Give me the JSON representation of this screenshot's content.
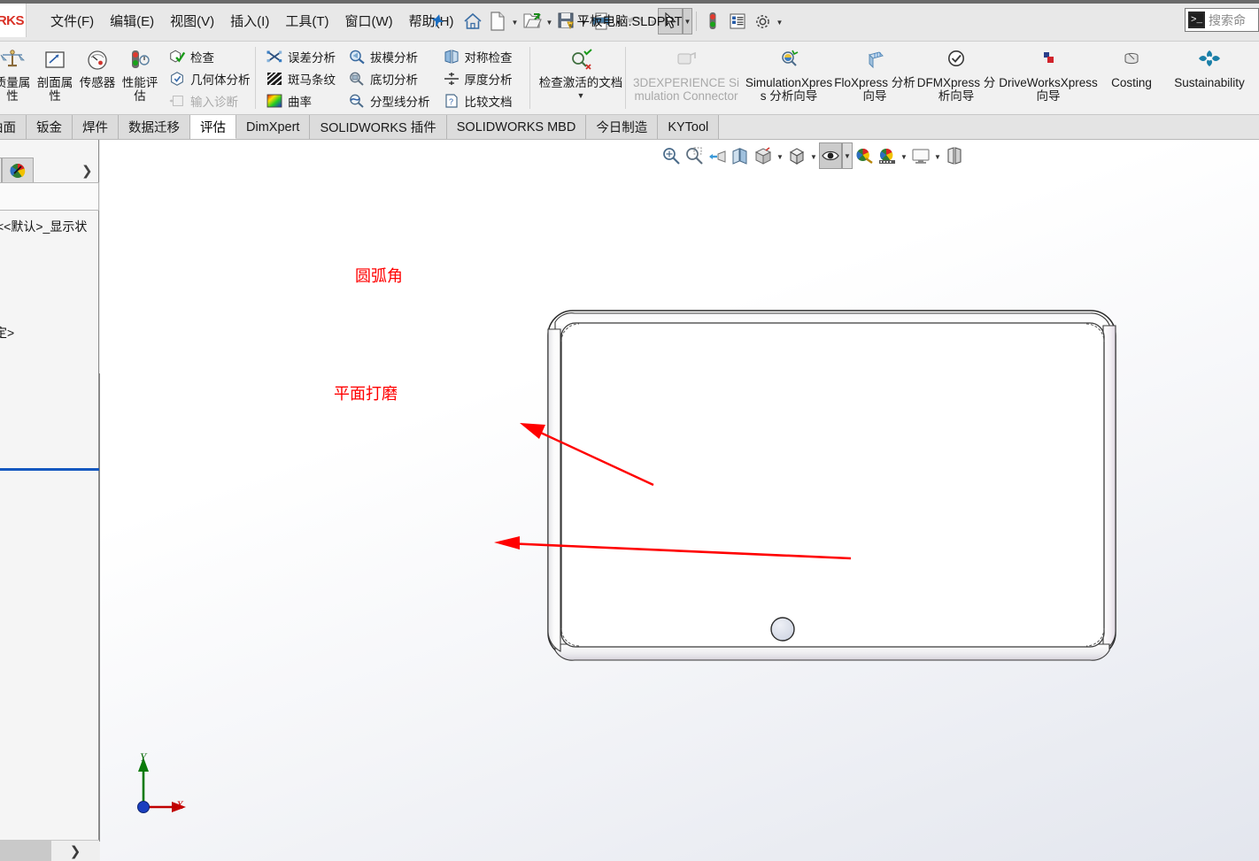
{
  "window": {
    "document_title": "平板电脑.SLDPRT",
    "app_logo_text": "RKS"
  },
  "menubar": {
    "items": [
      {
        "label": "文件(F)",
        "name": "menu-file"
      },
      {
        "label": "编辑(E)",
        "name": "menu-edit"
      },
      {
        "label": "视图(V)",
        "name": "menu-view"
      },
      {
        "label": "插入(I)",
        "name": "menu-insert"
      },
      {
        "label": "工具(T)",
        "name": "menu-tools"
      },
      {
        "label": "窗口(W)",
        "name": "menu-window"
      },
      {
        "label": "帮助(H)",
        "name": "menu-help"
      }
    ],
    "pin_icon": "pin-icon"
  },
  "quick_access": {
    "buttons": [
      {
        "name": "home-icon",
        "tooltip": "主页"
      },
      {
        "name": "new-document-icon",
        "tooltip": "新建"
      },
      {
        "name": "open-document-icon",
        "tooltip": "打开"
      },
      {
        "name": "save-icon",
        "tooltip": "保存"
      },
      {
        "name": "print-icon",
        "tooltip": "打印"
      },
      {
        "name": "undo-icon",
        "tooltip": "撤销"
      },
      {
        "name": "select-cursor-icon",
        "tooltip": "选择"
      },
      {
        "name": "rebuild-traffic-light-icon",
        "tooltip": "重建模型"
      },
      {
        "name": "file-properties-icon",
        "tooltip": "文件属性"
      },
      {
        "name": "options-gear-icon",
        "tooltip": "选项"
      }
    ]
  },
  "search": {
    "placeholder": "搜索命",
    "icon": "command-search-icon"
  },
  "ribbon": {
    "groups": [
      {
        "name": "evaluate-main",
        "big_buttons": [
          {
            "label": "质量属性",
            "icon": "mass-properties-icon",
            "name": "mass-properties-button"
          },
          {
            "label": "剖面属性",
            "icon": "section-properties-icon",
            "name": "section-properties-button"
          },
          {
            "label": "传感器",
            "icon": "sensor-icon",
            "name": "sensor-button"
          },
          {
            "label": "性能评估",
            "icon": "performance-evaluation-icon",
            "name": "performance-evaluation-button"
          }
        ],
        "small_buttons": [
          {
            "label": "检查",
            "icon": "check-icon",
            "name": "check-button",
            "disabled": false
          },
          {
            "label": "几何体分析",
            "icon": "geometry-analysis-icon",
            "name": "geometry-analysis-button",
            "disabled": false
          },
          {
            "label": "输入诊断",
            "icon": "import-diagnostics-icon",
            "name": "import-diagnostics-button",
            "disabled": true
          }
        ]
      },
      {
        "name": "analysis-columns",
        "column_1": [
          {
            "label": "误差分析",
            "icon": "deviation-analysis-icon",
            "name": "deviation-analysis-button"
          },
          {
            "label": "斑马条纹",
            "icon": "zebra-stripes-icon",
            "name": "zebra-stripes-button"
          },
          {
            "label": "曲率",
            "icon": "curvature-icon",
            "name": "curvature-button"
          }
        ],
        "column_2": [
          {
            "label": "拔模分析",
            "icon": "draft-analysis-icon",
            "name": "draft-analysis-button"
          },
          {
            "label": "底切分析",
            "icon": "undercut-analysis-icon",
            "name": "undercut-analysis-button"
          },
          {
            "label": "分型线分析",
            "icon": "parting-line-analysis-icon",
            "name": "parting-line-analysis-button"
          }
        ],
        "column_3": [
          {
            "label": "对称检查",
            "icon": "symmetry-check-icon",
            "name": "symmetry-check-button"
          },
          {
            "label": "厚度分析",
            "icon": "thickness-analysis-icon",
            "name": "thickness-analysis-button"
          },
          {
            "label": "比较文档",
            "icon": "compare-documents-icon",
            "name": "compare-documents-button"
          }
        ]
      },
      {
        "name": "check-active-document",
        "big_buttons": [
          {
            "label": "检查激活的文档",
            "icon": "check-active-document-icon",
            "name": "check-active-document-button",
            "has_dropdown": true
          }
        ]
      },
      {
        "name": "xpress-tools",
        "big_buttons": [
          {
            "label": "3DEXPERIENCE Simulation Connector",
            "icon": "3dexperience-simulation-connector-icon",
            "name": "3dexperience-simulation-connector-button",
            "disabled": true
          },
          {
            "label": "SimulationXpress 分析向导",
            "icon": "simulationxpress-icon",
            "name": "simulationxpress-button"
          },
          {
            "label": "FloXpress 分析向导",
            "icon": "floxpress-icon",
            "name": "floxpress-button"
          },
          {
            "label": "DFMXpress 分析向导",
            "icon": "dfmxpress-icon",
            "name": "dfmxpress-button"
          },
          {
            "label": "DriveWorksXpress 向导",
            "icon": "driveworksxpress-icon",
            "name": "driveworksxpress-button"
          },
          {
            "label": "Costing",
            "icon": "costing-icon",
            "name": "costing-button"
          },
          {
            "label": "Sustainability",
            "icon": "sustainability-icon",
            "name": "sustainability-button"
          }
        ]
      }
    ]
  },
  "tabs": {
    "items": [
      {
        "label": "曲面",
        "name": "tab-surfaces",
        "active": false
      },
      {
        "label": "钣金",
        "name": "tab-sheet-metal",
        "active": false
      },
      {
        "label": "焊件",
        "name": "tab-weldments",
        "active": false
      },
      {
        "label": "数据迁移",
        "name": "tab-data-migration",
        "active": false
      },
      {
        "label": "评估",
        "name": "tab-evaluate",
        "active": true
      },
      {
        "label": "DimXpert",
        "name": "tab-dimxpert",
        "active": false
      },
      {
        "label": "SOLIDWORKS 插件",
        "name": "tab-solidworks-addins",
        "active": false
      },
      {
        "label": "SOLIDWORKS MBD",
        "name": "tab-solidworks-mbd",
        "active": false
      },
      {
        "label": "今日制造",
        "name": "tab-manufacturing-today",
        "active": false
      },
      {
        "label": "KYTool",
        "name": "tab-kytool",
        "active": false
      }
    ]
  },
  "left_panel": {
    "tabs": [
      {
        "name": "feature-manager-design-tree-icon"
      },
      {
        "name": "display-manager-icon"
      }
    ],
    "expand_chevron": "chevron-right-icon",
    "tree_lines": [
      {
        "text": "<<默认>_显示状",
        "name": "tree-item-display-state"
      },
      {
        "text": "定>",
        "name": "tree-item-annotations"
      }
    ],
    "bottom_chevron": "chevron-right-icon"
  },
  "view_toolbar": {
    "buttons": [
      {
        "name": "zoom-to-fit-icon"
      },
      {
        "name": "zoom-to-area-icon"
      },
      {
        "name": "previous-view-icon"
      },
      {
        "name": "section-view-icon"
      },
      {
        "name": "view-orientation-icon"
      },
      {
        "name": "display-style-icon",
        "has_dropdown": true
      },
      {
        "name": "hide-show-items-icon",
        "has_dropdown": true
      },
      {
        "name": "edit-appearance-icon"
      },
      {
        "name": "apply-scene-icon",
        "has_dropdown": true
      },
      {
        "name": "view-settings-icon",
        "has_dropdown": true
      },
      {
        "name": "viewport-icon"
      }
    ]
  },
  "graphics": {
    "annotations": [
      {
        "text": "圆弧角",
        "name": "annotation-rounded-corner",
        "color": "#ff0000"
      },
      {
        "text": "平面打磨",
        "name": "annotation-surface-grinding",
        "color": "#ff0000"
      }
    ],
    "model": {
      "name": "tablet-computer-model",
      "description": "平板电脑"
    },
    "triad": {
      "x_label": "X",
      "y_label": "Y",
      "x_color": "#cc0000",
      "y_color": "#006600",
      "origin_color": "#1a3fbf"
    }
  },
  "colors": {
    "accent": "#1558c0",
    "annotation_red": "#ff0000",
    "ribbon_bg": "#f1f1f1",
    "tab_active_bg": "#ffffff"
  }
}
